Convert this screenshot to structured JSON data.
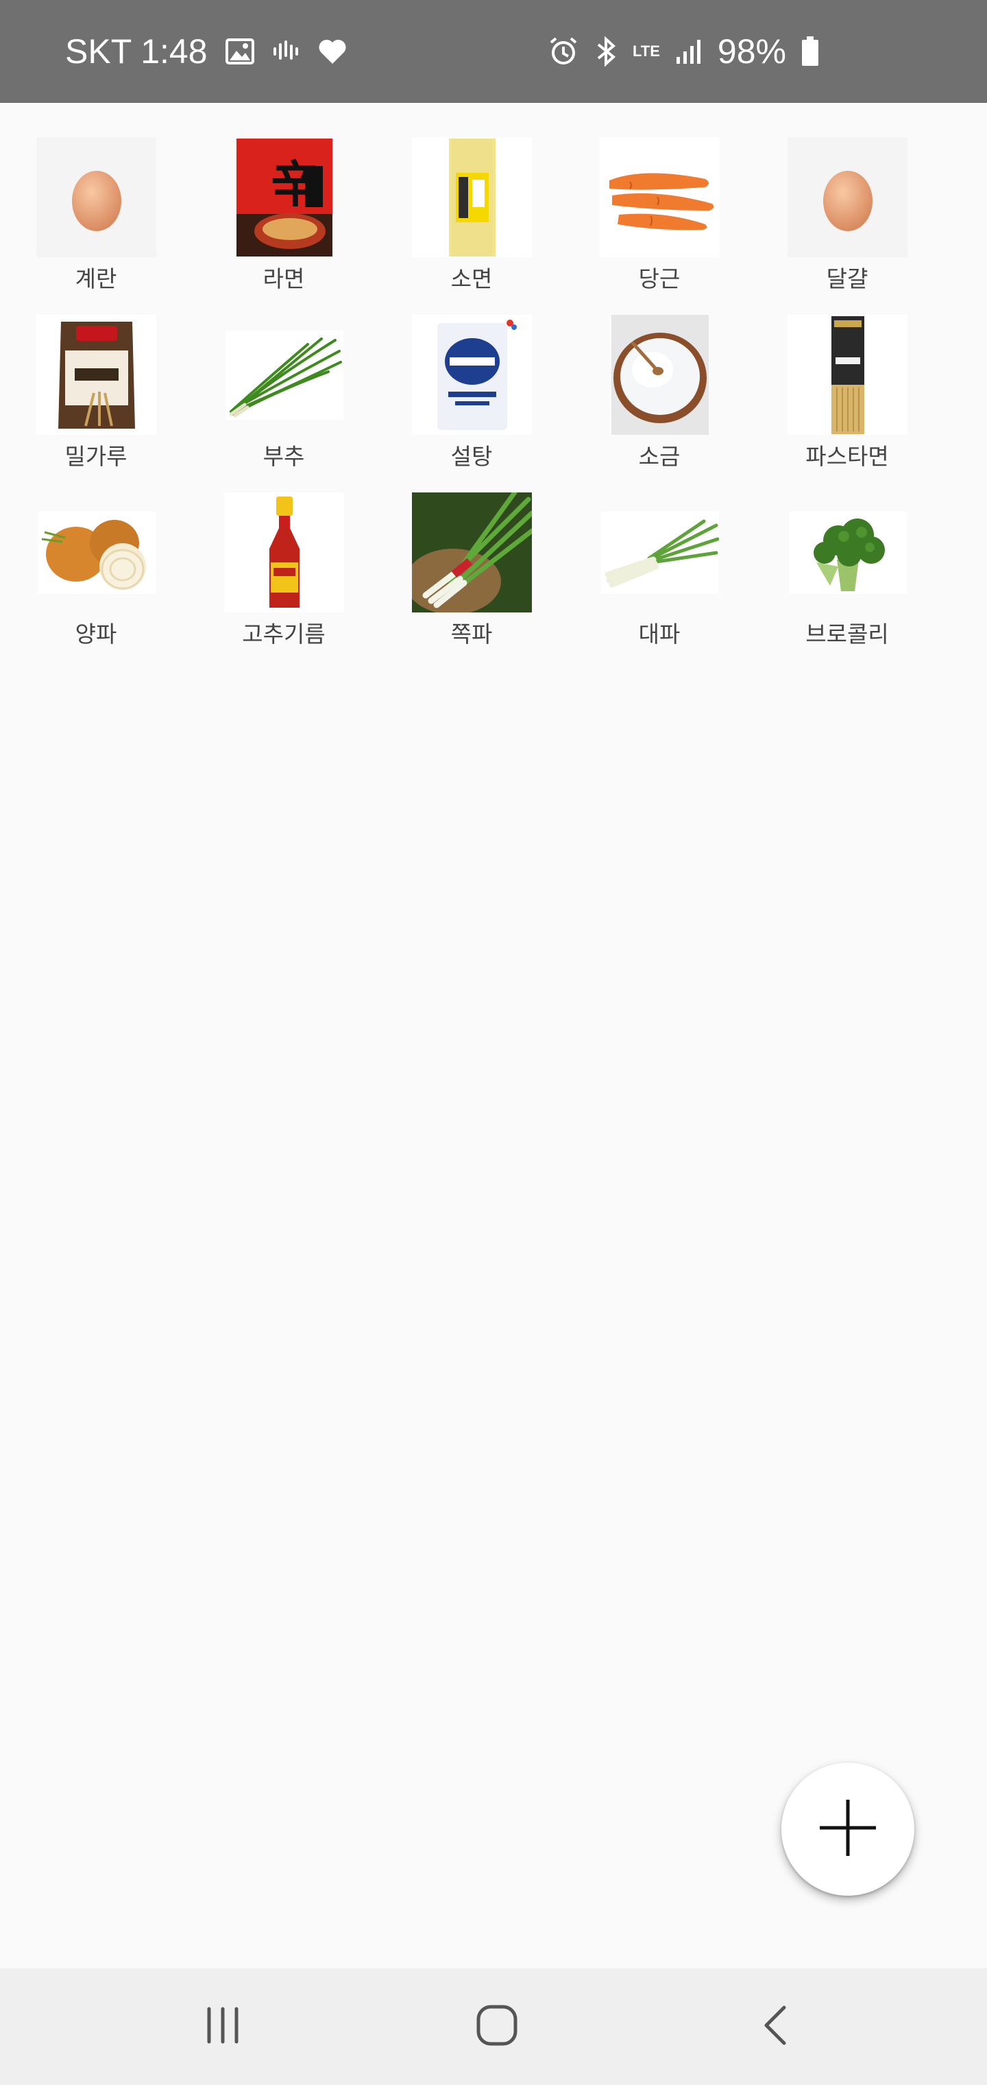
{
  "status_bar": {
    "carrier_time": "SKT 1:48",
    "network": "LTE",
    "battery": "98%",
    "left_icons": [
      "image-icon",
      "voicemail-icon",
      "heart-icon"
    ],
    "right_icons": [
      "alarm-icon",
      "bluetooth-icon",
      "lte-icon",
      "signal-icon",
      "battery-icon"
    ]
  },
  "ingredients": [
    {
      "label": "계란",
      "icon": "egg-icon"
    },
    {
      "label": "라면",
      "icon": "ramen-package-icon"
    },
    {
      "label": "소면",
      "icon": "somen-noodles-icon"
    },
    {
      "label": "당근",
      "icon": "carrot-icon"
    },
    {
      "label": "달걀",
      "icon": "egg-icon"
    },
    {
      "label": "밀가루",
      "icon": "flour-bag-icon"
    },
    {
      "label": "부추",
      "icon": "chives-icon"
    },
    {
      "label": "설탕",
      "icon": "sugar-bag-icon"
    },
    {
      "label": "소금",
      "icon": "salt-bowl-icon"
    },
    {
      "label": "파스타면",
      "icon": "pasta-package-icon"
    },
    {
      "label": "양파",
      "icon": "onion-icon"
    },
    {
      "label": "고추기름",
      "icon": "chili-oil-bottle-icon"
    },
    {
      "label": "쪽파",
      "icon": "green-onion-bundle-icon"
    },
    {
      "label": "대파",
      "icon": "leek-icon"
    },
    {
      "label": "브로콜리",
      "icon": "broccoli-icon"
    }
  ],
  "fab": {
    "icon": "plus-icon"
  },
  "nav_bar": {
    "recents": "recents-icon",
    "home": "home-icon",
    "back": "back-icon"
  },
  "colors": {
    "status_bar": "#707070",
    "background": "#fafafa",
    "nav_bar": "#efefef",
    "label_text": "#444444"
  }
}
